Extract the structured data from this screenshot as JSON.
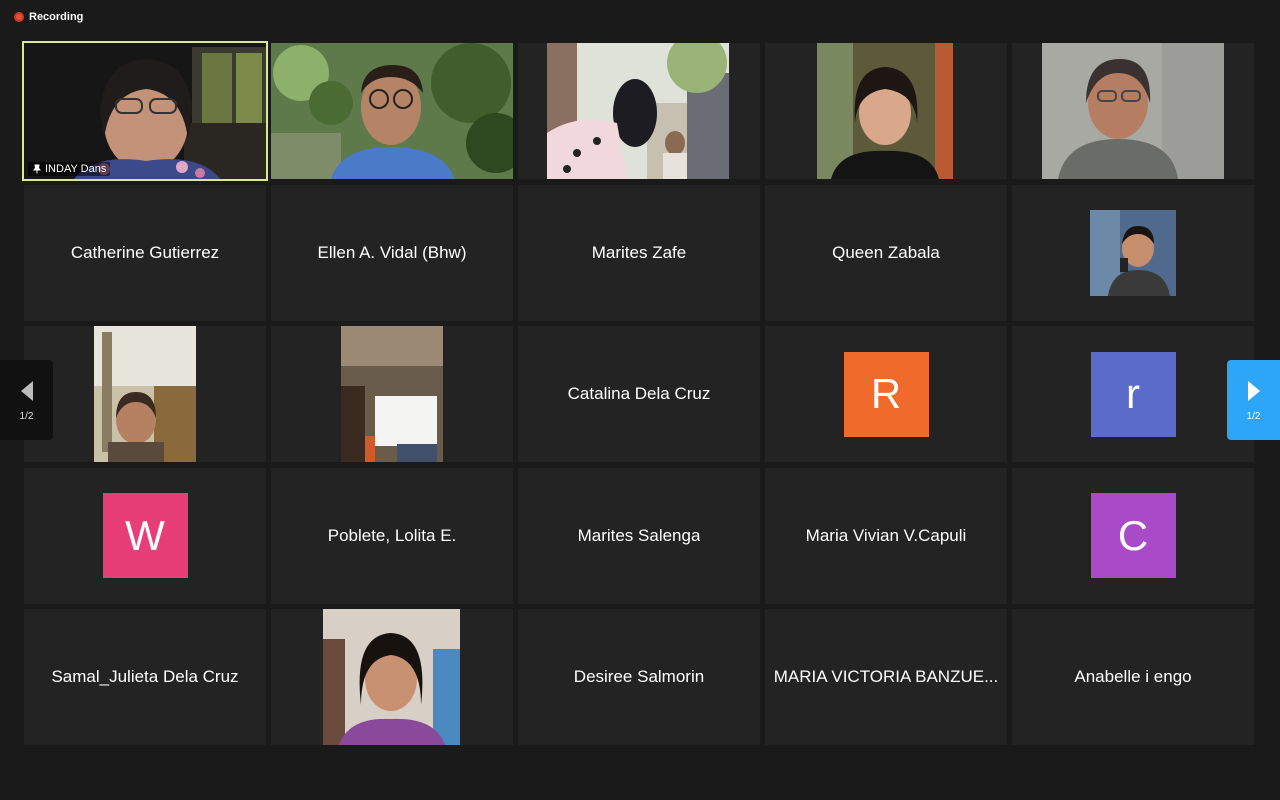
{
  "recording": {
    "label": "Recording"
  },
  "active_speaker": {
    "name": "INDAY Dans"
  },
  "participants": {
    "catherine": "Catherine Gutierrez",
    "ellen": "Ellen A.  Vidal (Bhw)",
    "marites_zafe": "Marites Zafe",
    "queen": "Queen Zabala",
    "catalina": "Catalina Dela Cruz",
    "poblete": "Poblete, Lolita E.",
    "marites_salenga": "Marites Salenga",
    "maria_vivian": "Maria Vivian V.Capuli",
    "samal": "Samal_Julieta Dela Cruz",
    "desiree": "Desiree Salmorin",
    "maria_victoria": "MARIA VICTORIA BANZUE...",
    "anabelle": "Anabelle i engo"
  },
  "avatars": {
    "r_upper": {
      "letter": "R",
      "color": "#f06a2c"
    },
    "r_lower": {
      "letter": "r",
      "color": "#5b6bc9"
    },
    "w": {
      "letter": "W",
      "color": "#e83e78"
    },
    "c": {
      "letter": "C",
      "color": "#a94ac8"
    }
  },
  "pagination": {
    "prev_label": "1/2",
    "next_label": "1/2"
  },
  "icons": {
    "prev": "chevron-left-icon",
    "next": "chevron-right-icon",
    "pin": "pin-icon",
    "recording": "record-dot-icon"
  },
  "colors": {
    "active_border": "#d9ea8c",
    "next_button": "#2ea6f7",
    "tile_bg": "#232323",
    "page_bg": "#1a1a1a"
  }
}
